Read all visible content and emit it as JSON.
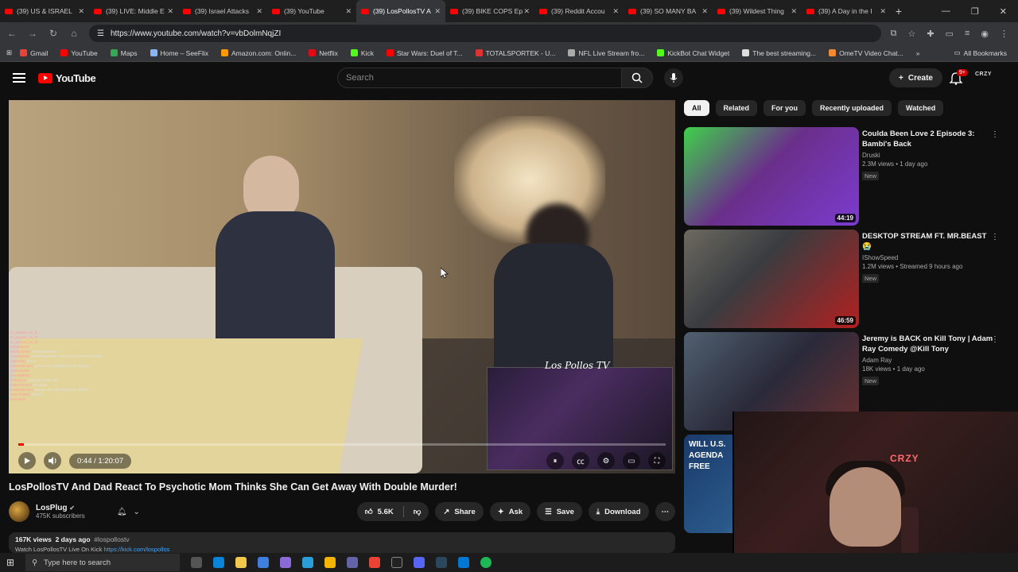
{
  "browser": {
    "tabs": [
      {
        "title": "(39) US & ISRAEL"
      },
      {
        "title": "(39) LIVE: Middle E"
      },
      {
        "title": "(39) Israel Attacks"
      },
      {
        "title": "(39) YouTube"
      },
      {
        "title": "(39) LosPollosTV A"
      },
      {
        "title": "(39) BIKE COPS Ep"
      },
      {
        "title": "(39) Reddit Accou"
      },
      {
        "title": "(39) SO MANY BA"
      },
      {
        "title": "(39) Wildest Thing"
      },
      {
        "title": "(39) A Day in the I"
      }
    ],
    "active_tab_index": 4,
    "url": "https://www.youtube.com/watch?v=vbDolmNqjZI",
    "bookmarks": [
      {
        "label": "Gmail",
        "color": "#ea4335"
      },
      {
        "label": "YouTube",
        "color": "#ff0000"
      },
      {
        "label": "Maps",
        "color": "#34a853"
      },
      {
        "label": "Home – SeeFlix",
        "color": "#8ab4f8"
      },
      {
        "label": "Amazon.com: Onlin...",
        "color": "#ff9900"
      },
      {
        "label": "Netflix",
        "color": "#e50914"
      },
      {
        "label": "Kick",
        "color": "#53fc18"
      },
      {
        "label": "Star Wars: Duel of T...",
        "color": "#ff0000"
      },
      {
        "label": "TOTALSPORTEK - U...",
        "color": "#d33"
      },
      {
        "label": "NFL Live Stream fro...",
        "color": "#aaaaaa"
      },
      {
        "label": "KickBot Chat Widget",
        "color": "#53fc18"
      },
      {
        "label": "The best streaming...",
        "color": "#dddddd"
      },
      {
        "label": "OmeTV Video Chat...",
        "color": "#f28b30"
      }
    ],
    "all_bookmarks_label": "All Bookmarks"
  },
  "youtube": {
    "logo_text": "YouTube",
    "search_placeholder": "Search",
    "create_label": "Create",
    "notification_badge": "9+",
    "avatar_text": "CRZY"
  },
  "player": {
    "time_current": "0:44",
    "time_separator": " / ",
    "time_total": "1:20:07",
    "progress": 0.009,
    "cam_overlay_text": "Los Pollos TV",
    "chat_lines": [
      {
        "user": "dr_pepper_on_dr",
        "msg": ""
      },
      {
        "user": "dr_pepper_on_dr",
        "msg": ""
      },
      {
        "user": "dr_pepper_on_dr",
        "msg": ""
      },
      {
        "user": "McBankster",
        "msg": ""
      },
      {
        "user": "freddyrichter:",
        "msg": "already passed"
      },
      {
        "user": "shoot88888:",
        "msg": "WATCH DANIEL LARSON DOCUMENTARY"
      },
      {
        "user": "edenoble:",
        "msg": "fax lol"
      },
      {
        "user": "KwameBrown:",
        "msg": "women shouldn't be police officers"
      },
      {
        "user": "McBankster:",
        "msg": ""
      },
      {
        "user": "shoot88888:",
        "msg": ""
      },
      {
        "user": "Pokeyz12:",
        "msg": "they got drake man"
      },
      {
        "user": "GabeVincent:",
        "msg": "sfc drake"
      },
      {
        "user": "KwameBrown:",
        "msg": "women shouldn't be police officers"
      },
      {
        "user": "sweet43088:",
        "msg": "drizzy?"
      },
      {
        "user": "itsmoshie:",
        "msg": ""
      }
    ]
  },
  "video": {
    "title": "LosPollosTV And Dad React To Psychotic Mom Thinks She Can Get Away With Double Murder!",
    "channel_name": "LosPlug",
    "subscribers": "475K subscribers",
    "likes": "5.6K",
    "share_label": "Share",
    "ask_label": "Ask",
    "save_label": "Save",
    "download_label": "Download",
    "views": "167K views",
    "age": "2 days ago",
    "hashtag": "#lospollostv",
    "desc_line2": "Watch LosPollosTV Live On Kick",
    "desc_link": "https://kick.com/lospollos"
  },
  "sidebar": {
    "chips": [
      "All",
      "Related",
      "For you",
      "Recently uploaded",
      "Watched"
    ],
    "active_chip": 0,
    "recommendations": [
      {
        "title": "Coulda Been Love 2 Episode 3: Bambi's Back",
        "channel": "Druski",
        "meta": "2.3M views • 1 day ago",
        "badge": "New",
        "duration": "44:19"
      },
      {
        "title": "DESKTOP STREAM FT. MR.BEAST 😭",
        "channel": "IShowSpeed",
        "meta": "1.2M views • Streamed 9 hours ago",
        "badge": "New",
        "duration": "46:59"
      },
      {
        "title": "Jeremy is BACK on Kill Tony | Adam Ray Comedy @Kill Tony",
        "channel": "Adam Ray",
        "meta": "18K views • 1 day ago",
        "badge": "New",
        "duration": ""
      },
      {
        "title": "",
        "channel": "",
        "meta": "",
        "badge": "",
        "duration": "",
        "thumb_text": "WILL U.S. AGENDA FREE"
      }
    ]
  },
  "facecam": {
    "sign_text": "CRZY"
  },
  "taskbar": {
    "search_placeholder": "Type here to search"
  }
}
